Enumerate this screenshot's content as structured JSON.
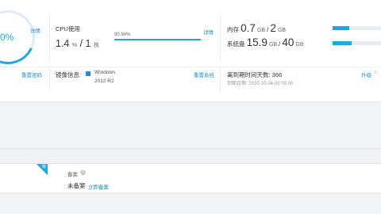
{
  "overview": {
    "ring_text": "0%",
    "detail_left": "详情",
    "cpu": {
      "title": "CPU使用",
      "percent": "1.4",
      "percent_unit": "%",
      "sep": " / ",
      "cores": "1",
      "cores_unit": "核",
      "usage_label": "90.94%",
      "usage_fraction": 0.9094,
      "detail": "详情"
    },
    "memory": {
      "label": "内存",
      "used": "0.7",
      "used_unit": "GB",
      "sep": " / ",
      "total": "2",
      "total_unit": "GB",
      "fraction": 0.35
    },
    "disk": {
      "label": "系统盘",
      "used": "15.9",
      "used_unit": "GB",
      "sep": " / ",
      "total": "40",
      "total_unit": "GB",
      "fraction": 0.4
    },
    "reset_password": "重置密码",
    "image": {
      "label": "镜像信息:",
      "os_line1": "Windows",
      "os_line2": "2012 R2",
      "reset_system": "重置系统"
    },
    "expiry": {
      "days_text": "离到期时间天数: 366",
      "date_text": "到期日期: 2020-10-06-00:00:00",
      "upgrade": "升级"
    }
  },
  "filing": {
    "corner_tag": "荐",
    "title": "备案",
    "status": "未备案",
    "link": "立即备案"
  },
  "colors": {
    "accent": "#1aa8e6",
    "link": "#1a8fe3"
  }
}
